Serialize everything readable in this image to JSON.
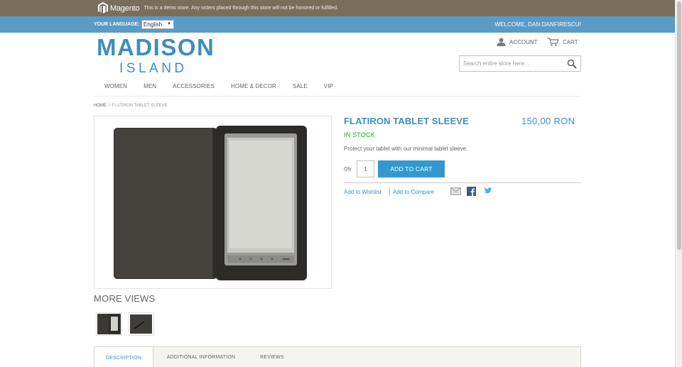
{
  "demo_notice": {
    "logo_text": "Magento",
    "message": "This is a demo store. Any orders placed through this store will not be honored or fulfilled."
  },
  "language_bar": {
    "label": "YOUR LANGUAGE:",
    "selected": "English",
    "welcome": "WELCOME, DAN DANFIRESCU!"
  },
  "header": {
    "brand_line1": "MADISON",
    "brand_line2": "ISLAND",
    "account_label": "ACCOUNT",
    "cart_label": "CART",
    "search_placeholder": "Search entire store here..."
  },
  "nav": {
    "items": [
      "WOMEN",
      "MEN",
      "ACCESSORIES",
      "HOME & DECOR",
      "SALE",
      "VIP"
    ]
  },
  "breadcrumb": {
    "home": "HOME",
    "separator": "/",
    "current": "FLATIRON TABLET SLEEVE"
  },
  "product": {
    "name": "FLATIRON TABLET SLEEVE",
    "price": "150,00 RON",
    "stock": "IN STOCK",
    "description": "Protect your tablet with our minimal tablet sleeve.",
    "qty_label": "Qty",
    "qty_value": "1",
    "add_to_cart": "ADD TO CART",
    "wishlist": "Add to Wishlist",
    "compare": "Add to Compare",
    "more_views": "MORE VIEWS"
  },
  "tabs": {
    "items": [
      "DESCRIPTION",
      "ADDITIONAL INFORMATION",
      "REVIEWS"
    ],
    "active": "DESCRIPTION"
  },
  "colors": {
    "demo_bar": "#786f5b",
    "lang_bar": "#5a9bc6",
    "brand": "#3c8fbf",
    "button": "#3399cc",
    "in_stock": "#11b400"
  },
  "icons": [
    "magento-logo-icon",
    "account-icon",
    "cart-icon",
    "search-icon",
    "email-icon",
    "facebook-icon",
    "twitter-icon"
  ]
}
